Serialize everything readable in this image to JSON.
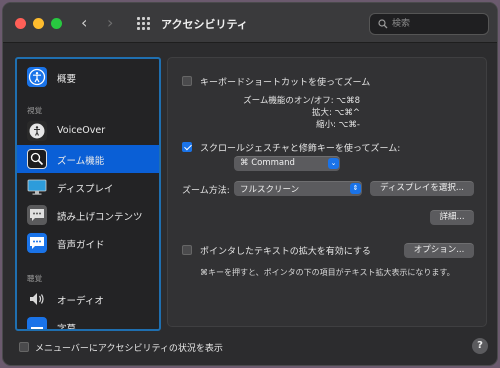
{
  "window": {
    "title": "アクセシビリティ"
  },
  "search": {
    "placeholder": "検索",
    "value": ""
  },
  "sidebar": {
    "items": [
      {
        "label": "概要",
        "icon": "accessibility-icon"
      },
      {
        "label": "VoiceOver",
        "icon": "voiceover-icon"
      },
      {
        "label": "ズーム機能",
        "icon": "zoom-icon",
        "selected": true
      },
      {
        "label": "ディスプレイ",
        "icon": "display-icon"
      },
      {
        "label": "読み上げコンテンツ",
        "icon": "spoken-content-icon"
      },
      {
        "label": "音声ガイド",
        "icon": "descriptions-icon"
      },
      {
        "label": "オーディオ",
        "icon": "audio-icon"
      },
      {
        "label": "字幕",
        "icon": "captions-icon"
      }
    ],
    "sections": {
      "vision": "視覚",
      "hearing": "聴覚"
    }
  },
  "zoom": {
    "keyboard_shortcuts": {
      "label": "キーボードショートカットを使ってズーム",
      "checked": false,
      "lines": [
        "ズーム機能のオン/オフ:  ⌥⌘8",
        "拡大:  ⌥⌘^",
        "縮小:  ⌥⌘-"
      ]
    },
    "scroll_gesture": {
      "label": "スクロールジェスチャと修飾キーを使ってズーム:",
      "checked": true,
      "modifier": "⌘ Command"
    },
    "style": {
      "label": "ズーム方法:",
      "value": "フルスクリーン",
      "select_display_button": "ディスプレイを選択..."
    },
    "details_button": "詳細...",
    "hover_text": {
      "label": "ポインタしたテキストの拡大を有効にする",
      "checked": false,
      "options_button": "オプション...",
      "hint": "⌘キーを押すと、ポインタの下の項目がテキスト拡大表示になります。"
    }
  },
  "footer": {
    "show_in_menubar": "メニューバーにアクセシビリティの状況を表示",
    "show_in_menubar_checked": false,
    "help": "?"
  },
  "colors": {
    "accent": "#1a73e8",
    "selected_row": "#0a5fd6",
    "sidebar_border": "#1f6fb0"
  }
}
